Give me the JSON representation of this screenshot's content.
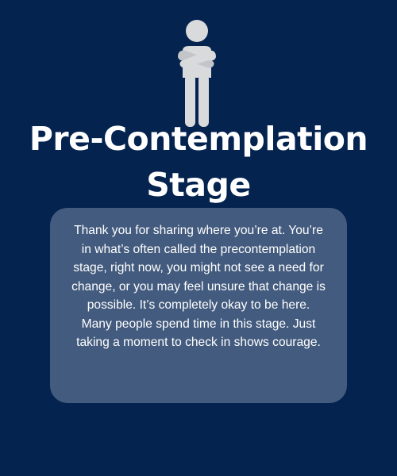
{
  "header": {
    "title_line1": "Pre-Contemplation",
    "title_line2": "Stage",
    "icon": "person-arms-crossed-icon"
  },
  "message": {
    "text": "Thank you for sharing where you’re at. You’re in what’s often called the precontemplation stage, right now, you might not see a need for change, or you may feel unsure that change is possible. It’s completely okay to be here. Many people spend time in this stage. Just taking a moment to check in shows courage."
  },
  "colors": {
    "background": "#04234f",
    "card": "#435b7e",
    "figure": "#d9dadc",
    "text": "#ffffff"
  }
}
